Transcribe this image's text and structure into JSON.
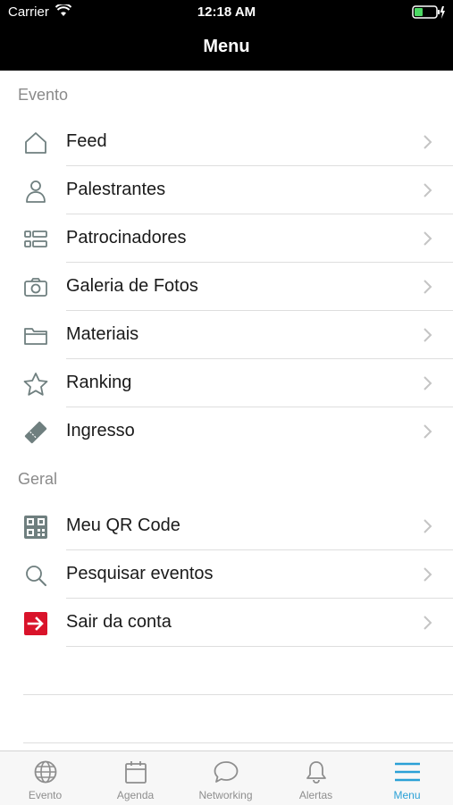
{
  "status_bar": {
    "carrier": "Carrier",
    "time": "12:18 AM"
  },
  "nav": {
    "title": "Menu"
  },
  "sections": {
    "evento": "Evento",
    "geral": "Geral"
  },
  "evento_items": [
    {
      "label": "Feed",
      "icon": "home-icon"
    },
    {
      "label": "Palestrantes",
      "icon": "person-icon"
    },
    {
      "label": "Patrocinadores",
      "icon": "list-grid-icon"
    },
    {
      "label": "Galeria de Fotos",
      "icon": "camera-icon"
    },
    {
      "label": "Materiais",
      "icon": "folder-icon"
    },
    {
      "label": "Ranking",
      "icon": "star-icon"
    },
    {
      "label": "Ingresso",
      "icon": "ticket-icon"
    }
  ],
  "geral_items": [
    {
      "label": "Meu QR Code",
      "icon": "qr-code-icon"
    },
    {
      "label": "Pesquisar eventos",
      "icon": "search-icon"
    },
    {
      "label": "Sair da conta",
      "icon": "logout-icon"
    }
  ],
  "tabs": [
    {
      "label": "Evento",
      "icon": "globe-icon"
    },
    {
      "label": "Agenda",
      "icon": "calendar-icon"
    },
    {
      "label": "Networking",
      "icon": "chat-bubble-icon"
    },
    {
      "label": "Alertas",
      "icon": "bell-icon"
    },
    {
      "label": "Menu",
      "icon": "hamburger-icon",
      "active": true
    }
  ],
  "colors": {
    "accent": "#2aa0d6",
    "icon_gray": "#7a8a8a",
    "logout_red": "#d9132a",
    "battery_green": "#4cd964"
  }
}
